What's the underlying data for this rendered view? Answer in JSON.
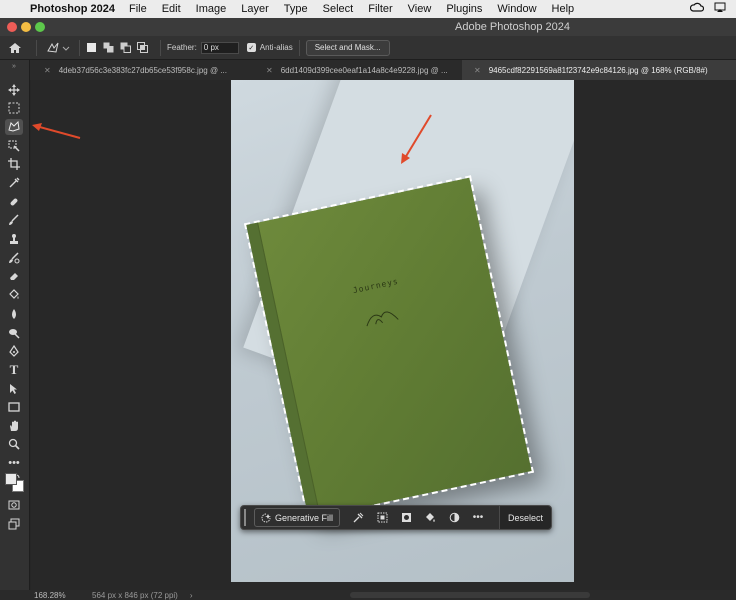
{
  "menubar": {
    "app_name": "Photoshop 2024",
    "items": [
      "File",
      "Edit",
      "Image",
      "Layer",
      "Type",
      "Select",
      "Filter",
      "View",
      "Plugins",
      "Window",
      "Help"
    ]
  },
  "window": {
    "title": "Adobe Photoshop 2024"
  },
  "options": {
    "feather_label": "Feather:",
    "feather_value": "0 px",
    "antialias_label": "Anti-alias",
    "select_mask_label": "Select and Mask..."
  },
  "tabs": [
    {
      "label": "4deb37d56c3e383fc27db65ce53f958c.jpg @ ...",
      "active": false
    },
    {
      "label": "6dd1409d399cee0eaf1a14a8c4e9228.jpg @ ...",
      "active": false
    },
    {
      "label": "9465cdf82291569a81f23742e9c84126.jpg @ 168% (RGB/8#)",
      "active": true
    }
  ],
  "document": {
    "book_title": "Journeys"
  },
  "context_bar": {
    "generative_fill_label": "Generative Fill",
    "deselect_label": "Deselect"
  },
  "status": {
    "zoom": "168.28%",
    "dimensions": "564 px x 846 px (72 ppi)"
  },
  "colors": {
    "annotation_arrow": "#e04a2b",
    "book_green": "#627e36"
  }
}
